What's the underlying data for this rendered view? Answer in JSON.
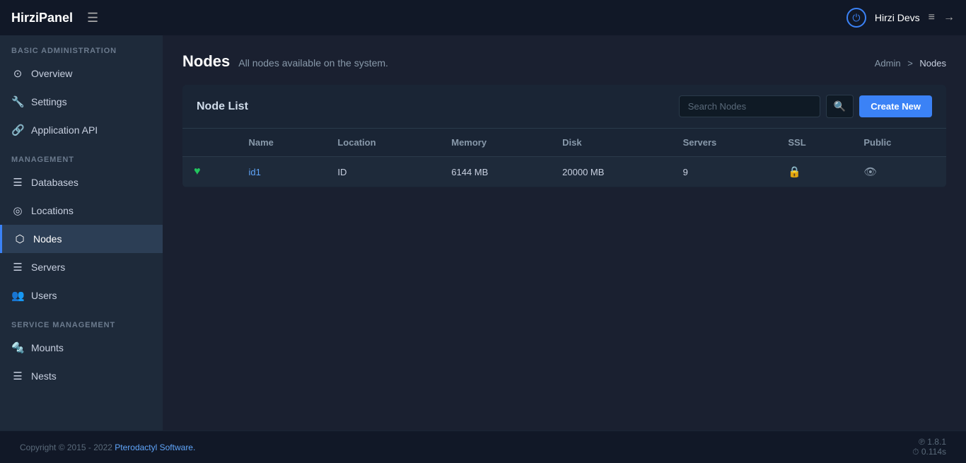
{
  "app": {
    "logo": "HirziPanel",
    "user": "Hirzi Devs"
  },
  "topbar": {
    "hamburger_icon": "☰",
    "power_icon": "⏻",
    "list_icon": "≡",
    "logout_icon": "→"
  },
  "sidebar": {
    "sections": [
      {
        "label": "BASIC ADMINISTRATION",
        "items": [
          {
            "id": "overview",
            "icon": "⊙",
            "label": "Overview",
            "active": false
          },
          {
            "id": "settings",
            "icon": "🔧",
            "label": "Settings",
            "active": false
          },
          {
            "id": "application-api",
            "icon": "🔗",
            "label": "Application API",
            "active": false
          }
        ]
      },
      {
        "label": "MANAGEMENT",
        "items": [
          {
            "id": "databases",
            "icon": "☰",
            "label": "Databases",
            "active": false
          },
          {
            "id": "locations",
            "icon": "◎",
            "label": "Locations",
            "active": false
          },
          {
            "id": "nodes",
            "icon": "⬡",
            "label": "Nodes",
            "active": true
          },
          {
            "id": "servers",
            "icon": "☰",
            "label": "Servers",
            "active": false
          },
          {
            "id": "users",
            "icon": "👥",
            "label": "Users",
            "active": false
          }
        ]
      },
      {
        "label": "SERVICE MANAGEMENT",
        "items": [
          {
            "id": "mounts",
            "icon": "🔩",
            "label": "Mounts",
            "active": false
          },
          {
            "id": "nests",
            "icon": "☰",
            "label": "Nests",
            "active": false
          }
        ]
      }
    ]
  },
  "page": {
    "title": "Nodes",
    "subtitle": "All nodes available on the system.",
    "breadcrumb_admin": "Admin",
    "breadcrumb_sep": ">",
    "breadcrumb_current": "Nodes"
  },
  "card": {
    "title": "Node List",
    "search_placeholder": "Search Nodes",
    "search_icon": "🔍",
    "create_button": "Create New"
  },
  "table": {
    "columns": [
      "",
      "Name",
      "Location",
      "Memory",
      "Disk",
      "Servers",
      "SSL",
      "Public"
    ],
    "rows": [
      {
        "status_icon": "♥",
        "name": "id1",
        "location": "ID",
        "memory": "6144 MB",
        "disk": "20000 MB",
        "servers": "9",
        "ssl": "🔒",
        "public": "👁"
      }
    ]
  },
  "footer": {
    "copyright": "Copyright © 2015 - 2022 ",
    "link_text": "Pterodactyl Software.",
    "version": "℗ 1.8.1",
    "time": "⏱ 0.114s"
  }
}
